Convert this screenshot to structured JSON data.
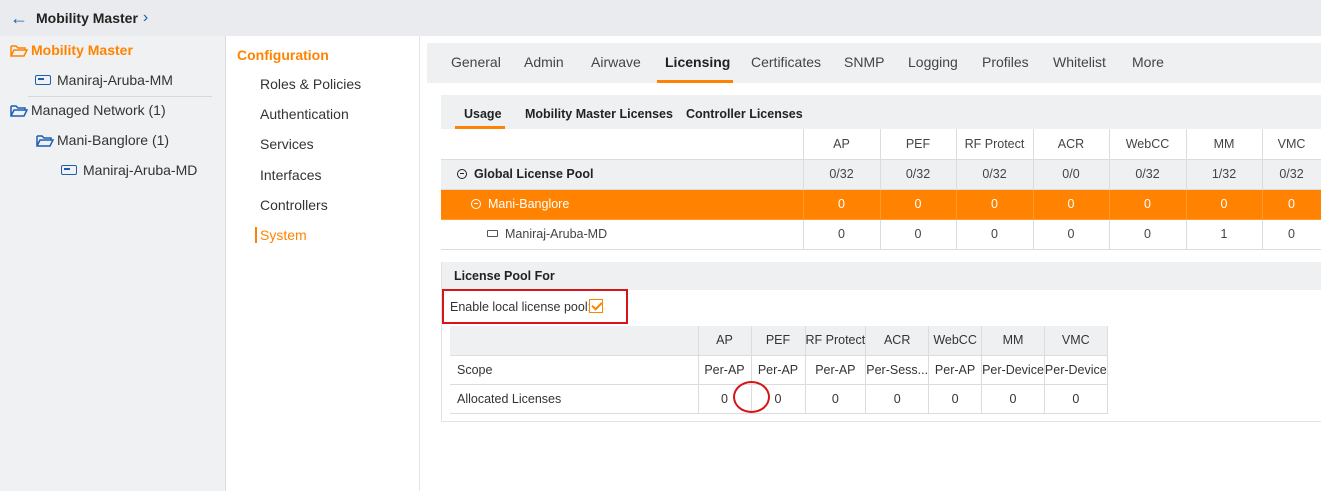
{
  "header": {
    "title": "Mobility Master"
  },
  "tree": {
    "root": "Mobility Master",
    "mm_device": "Maniraj-Aruba-MM",
    "managed_network": "Managed Network (1)",
    "group": "Mani-Banglore (1)",
    "md_device": "Maniraj-Aruba-MD"
  },
  "nav": {
    "heading": "Configuration",
    "items": [
      "Roles & Policies",
      "Authentication",
      "Services",
      "Interfaces",
      "Controllers",
      "System"
    ]
  },
  "tabs": [
    "General",
    "Admin",
    "Airwave",
    "Licensing",
    "Certificates",
    "SNMP",
    "Logging",
    "Profiles",
    "Whitelist",
    "More"
  ],
  "subtabs": [
    "Usage",
    "Mobility Master Licenses",
    "Controller Licenses"
  ],
  "usage_table": {
    "columns": [
      "AP",
      "PEF",
      "RF Protect",
      "ACR",
      "WebCC",
      "MM",
      "VMC"
    ],
    "rows": [
      {
        "name": "Global License Pool",
        "values": [
          "0/32",
          "0/32",
          "0/32",
          "0/0",
          "0/32",
          "1/32",
          "0/32"
        ]
      },
      {
        "name": "Mani-Banglore",
        "values": [
          "0",
          "0",
          "0",
          "0",
          "0",
          "0",
          "0"
        ]
      },
      {
        "name": "Maniraj-Aruba-MD",
        "values": [
          "0",
          "0",
          "0",
          "0",
          "0",
          "1",
          "0"
        ]
      }
    ]
  },
  "license_pool": {
    "heading": "License Pool For",
    "enable_label": "Enable local license pool:",
    "enabled": true,
    "columns": [
      "AP",
      "PEF",
      "RF Protect",
      "ACR",
      "WebCC",
      "MM",
      "VMC"
    ],
    "rows": [
      {
        "label": "Scope",
        "values": [
          "Per-AP",
          "Per-AP",
          "Per-AP",
          "Per-Sess...",
          "Per-AP",
          "Per-Device",
          "Per-Device"
        ]
      },
      {
        "label": "Allocated Licenses",
        "values": [
          "0",
          "0",
          "0",
          "0",
          "0",
          "0",
          "0"
        ]
      }
    ]
  },
  "colors": {
    "accent": "#ff8300",
    "link": "#1a5fb4",
    "highlight": "#d8141b"
  }
}
